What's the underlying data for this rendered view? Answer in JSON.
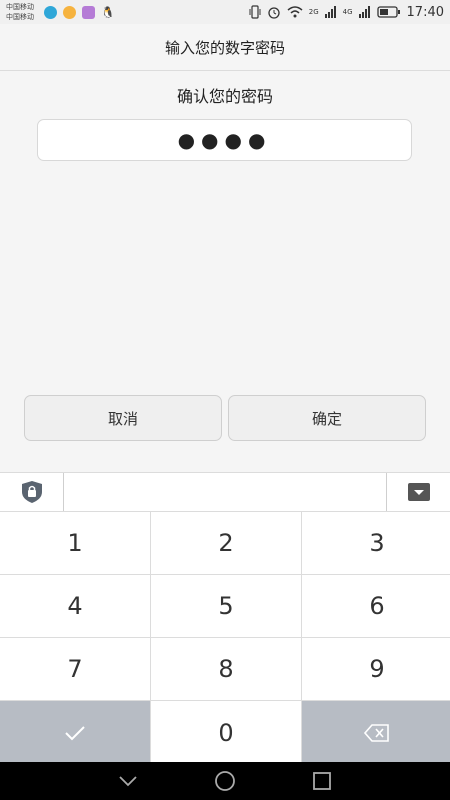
{
  "status_bar": {
    "carrier_1": "中国移动",
    "carrier_2": "中国移动",
    "network_2g": "2G",
    "network_4g": "4G",
    "time": "17:40"
  },
  "header": {
    "title": "输入您的数字密码"
  },
  "main": {
    "prompt": "确认您的密码",
    "password_mask": "●●●●",
    "cancel_label": "取消",
    "confirm_label": "确定"
  },
  "keyboard": {
    "keys": [
      "1",
      "2",
      "3",
      "4",
      "5",
      "6",
      "7",
      "8",
      "9",
      "0"
    ]
  },
  "colors": {
    "background": "#f5f5f5",
    "special_key": "#b7bcc4",
    "nav_bar": "#000000",
    "accent_shield": "#5a6470"
  }
}
